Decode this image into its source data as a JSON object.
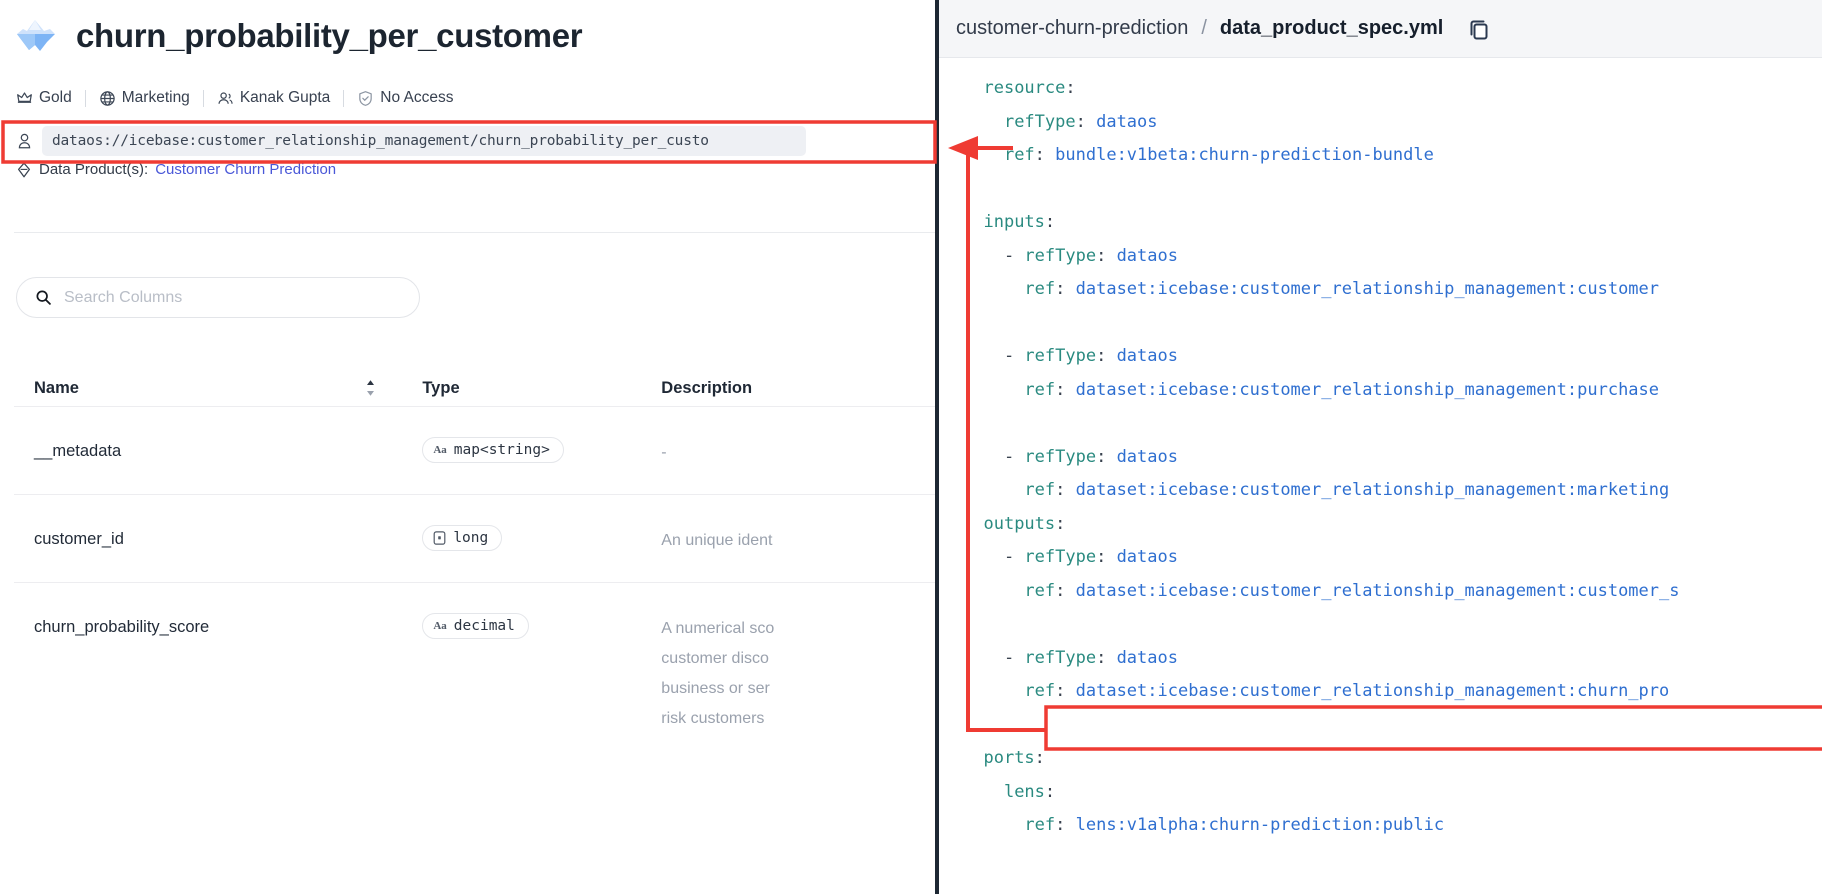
{
  "page": {
    "title": "churn_probability_per_customer",
    "title_icon": "iceberg-icon"
  },
  "meta": {
    "items": [
      {
        "icon": "crown-icon",
        "label": "Gold"
      },
      {
        "icon": "globe-icon",
        "label": "Marketing"
      },
      {
        "icon": "people-icon",
        "label": "Kanak Gupta"
      },
      {
        "icon": "shield-check-icon",
        "label": "No Access"
      }
    ]
  },
  "uri": {
    "icon": "key-icon",
    "value": "dataos://icebase:customer_relationship_management/churn_probability_per_custo"
  },
  "data_product": {
    "icon": "diamond-icon",
    "label": "Data Product(s):",
    "link": "Customer Churn Prediction"
  },
  "search": {
    "icon": "search-icon",
    "placeholder": "Search Columns",
    "value": ""
  },
  "table": {
    "columns": [
      {
        "key": "name",
        "label": "Name",
        "sortable": true
      },
      {
        "key": "type",
        "label": "Type",
        "sortable": false
      },
      {
        "key": "description",
        "label": "Description",
        "sortable": false
      }
    ],
    "rows": [
      {
        "name": "__metadata",
        "type": {
          "glyph": "Aa",
          "glyph_kind": "text-glyph",
          "text": "map<string>"
        },
        "description": "-"
      },
      {
        "name": "customer_id",
        "type": {
          "glyph": "",
          "glyph_kind": "number-glyph",
          "text": "long"
        },
        "description": "An unique ident"
      },
      {
        "name": "churn_probability_score",
        "type": {
          "glyph": "Aa",
          "glyph_kind": "text-glyph",
          "text": "decimal"
        },
        "description": "A numerical sco\ncustomer disco\nbusiness or ser\nrisk customers"
      }
    ]
  },
  "yml_panel": {
    "breadcrumb_repo": "customer-churn-prediction",
    "breadcrumb_separator": "/",
    "breadcrumb_file": "data_product_spec.yml",
    "copy_icon": "copy-icon",
    "lines": [
      {
        "indent": 1,
        "key": "resource",
        "colon": true,
        "value": ""
      },
      {
        "indent": 2,
        "key": "refType",
        "colon": true,
        "value": "dataos"
      },
      {
        "indent": 2,
        "key": "ref",
        "colon": true,
        "value": "bundle:v1beta:churn-prediction-bundle"
      },
      {
        "indent": 0,
        "key": "",
        "colon": false,
        "value": ""
      },
      {
        "indent": 1,
        "key": "inputs",
        "colon": true,
        "value": ""
      },
      {
        "indent": 2,
        "dash": true,
        "key": "refType",
        "colon": true,
        "value": "dataos"
      },
      {
        "indent": 3,
        "key": "ref",
        "colon": true,
        "value": "dataset:icebase:customer_relationship_management:customer"
      },
      {
        "indent": 0,
        "key": "",
        "colon": false,
        "value": ""
      },
      {
        "indent": 2,
        "dash": true,
        "key": "refType",
        "colon": true,
        "value": "dataos"
      },
      {
        "indent": 3,
        "key": "ref",
        "colon": true,
        "value": "dataset:icebase:customer_relationship_management:purchase"
      },
      {
        "indent": 0,
        "key": "",
        "colon": false,
        "value": ""
      },
      {
        "indent": 2,
        "dash": true,
        "key": "refType",
        "colon": true,
        "value": "dataos"
      },
      {
        "indent": 3,
        "key": "ref",
        "colon": true,
        "value": "dataset:icebase:customer_relationship_management:marketing"
      },
      {
        "indent": 1,
        "key": "outputs",
        "colon": true,
        "value": ""
      },
      {
        "indent": 2,
        "dash": true,
        "key": "refType",
        "colon": true,
        "value": "dataos"
      },
      {
        "indent": 3,
        "key": "ref",
        "colon": true,
        "value": "dataset:icebase:customer_relationship_management:customer_s"
      },
      {
        "indent": 0,
        "key": "",
        "colon": false,
        "value": ""
      },
      {
        "indent": 2,
        "dash": true,
        "key": "refType",
        "colon": true,
        "value": "dataos",
        "highlight_next": true
      },
      {
        "indent": 3,
        "key": "ref",
        "colon": true,
        "value": "dataset:icebase:customer_relationship_management:churn_pro",
        "highlighted": true
      },
      {
        "indent": 0,
        "key": "",
        "colon": false,
        "value": ""
      },
      {
        "indent": 1,
        "key": "ports",
        "colon": true,
        "value": ""
      },
      {
        "indent": 2,
        "key": "lens",
        "colon": true,
        "value": ""
      },
      {
        "indent": 3,
        "key": "ref",
        "colon": true,
        "value": "lens:v1alpha:churn-prediction:public"
      }
    ]
  },
  "annotation": {
    "color": "#ef3b33",
    "description": "Red callout linking the highlighted ref line in the YAML to the dataset URI field"
  },
  "colors": {
    "accent_link": "#4a58d8",
    "yaml_key": "#2a8a80",
    "yaml_value": "#2f6fd0",
    "annotation_red": "#ef3b33",
    "panel_border": "#1d2733"
  }
}
